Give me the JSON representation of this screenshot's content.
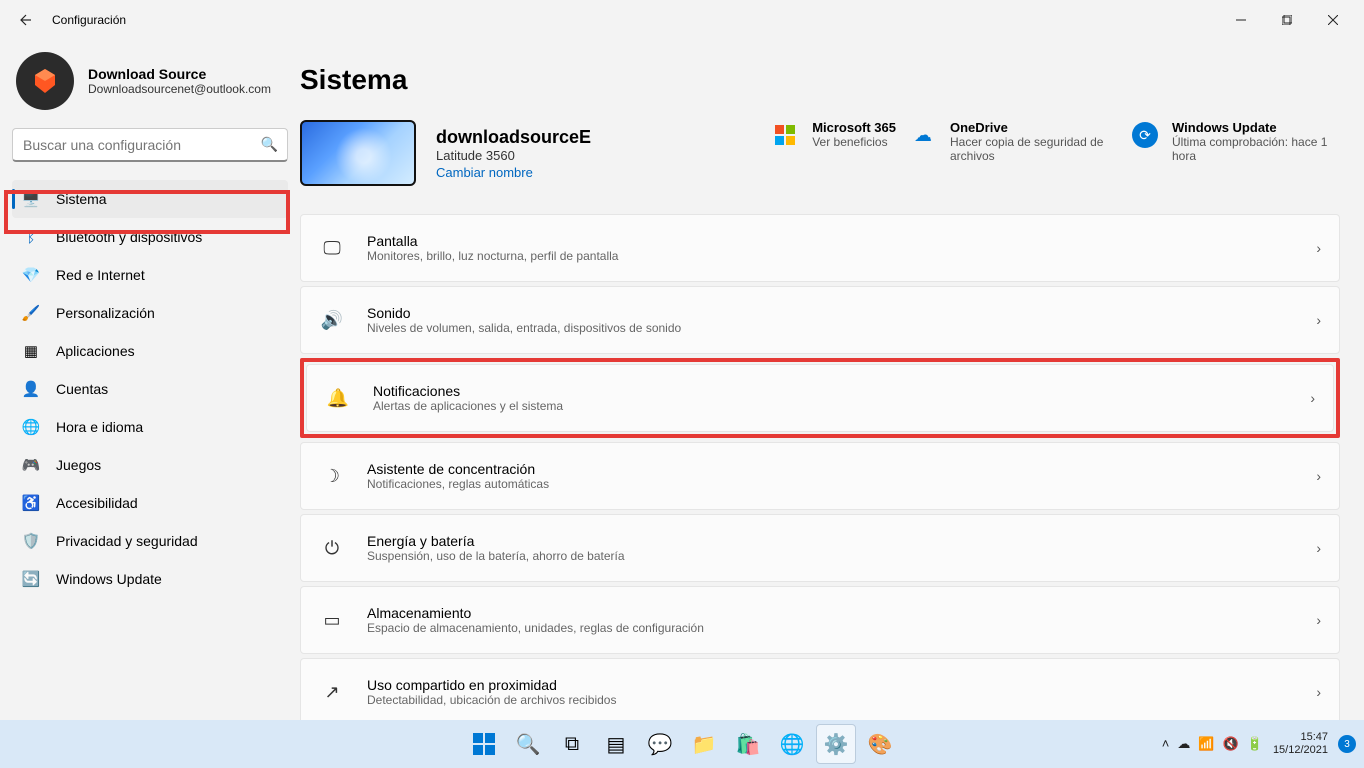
{
  "titlebar": {
    "title": "Configuración"
  },
  "profile": {
    "name": "Download Source",
    "email": "Downloadsourcenet@outlook.com"
  },
  "search": {
    "placeholder": "Buscar una configuración"
  },
  "nav": [
    {
      "label": "Sistema"
    },
    {
      "label": "Bluetooth y dispositivos"
    },
    {
      "label": "Red e Internet"
    },
    {
      "label": "Personalización"
    },
    {
      "label": "Aplicaciones"
    },
    {
      "label": "Cuentas"
    },
    {
      "label": "Hora e idioma"
    },
    {
      "label": "Juegos"
    },
    {
      "label": "Accesibilidad"
    },
    {
      "label": "Privacidad y seguridad"
    },
    {
      "label": "Windows Update"
    }
  ],
  "page_title": "Sistema",
  "device": {
    "name": "downloadsourceE",
    "model": "Latitude 3560",
    "rename": "Cambiar nombre"
  },
  "infocards": {
    "ms365": {
      "title": "Microsoft 365",
      "sub": "Ver beneficios"
    },
    "onedrive": {
      "title": "OneDrive",
      "sub": "Hacer copia de seguridad de archivos"
    },
    "wu": {
      "title": "Windows Update",
      "sub": "Última comprobación: hace 1 hora"
    }
  },
  "cards": {
    "pantalla": {
      "title": "Pantalla",
      "sub": "Monitores, brillo, luz nocturna, perfil de pantalla"
    },
    "sonido": {
      "title": "Sonido",
      "sub": "Niveles de volumen, salida, entrada, dispositivos de sonido"
    },
    "notif": {
      "title": "Notificaciones",
      "sub": "Alertas de aplicaciones y el sistema"
    },
    "focus": {
      "title": "Asistente de concentración",
      "sub": "Notificaciones, reglas automáticas"
    },
    "power": {
      "title": "Energía y batería",
      "sub": "Suspensión, uso de la batería, ahorro de batería"
    },
    "storage": {
      "title": "Almacenamiento",
      "sub": "Espacio de almacenamiento, unidades, reglas de configuración"
    },
    "share": {
      "title": "Uso compartido en proximidad",
      "sub": "Detectabilidad, ubicación de archivos recibidos"
    }
  },
  "taskbar": {
    "time": "15:47",
    "date": "15/12/2021",
    "badge": "3"
  }
}
